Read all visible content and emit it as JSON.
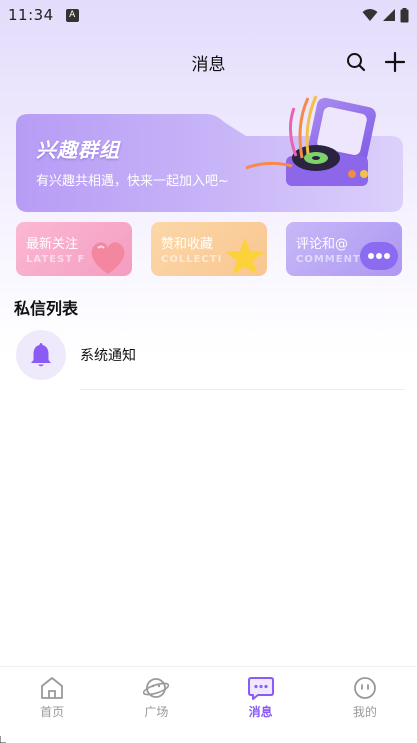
{
  "status_bar": {
    "time": "11:34",
    "badge": "A"
  },
  "header": {
    "title": "消息"
  },
  "banner": {
    "title": "兴趣群组",
    "subtitle": "有兴趣共相遇，快来一起加入吧~"
  },
  "cards": [
    {
      "label": "最新关注",
      "en": "LATEST F",
      "color": "#f7a7c8"
    },
    {
      "label": "赞和收藏",
      "en": "COLLECTI",
      "color": "#fbcf9d"
    },
    {
      "label": "评论和@",
      "en": "COMMENT",
      "color": "#b8a6f5"
    }
  ],
  "section_title": "私信列表",
  "dm_list": [
    {
      "name": "系统通知",
      "icon": "bell-icon"
    }
  ],
  "tabs": [
    {
      "label": "首页",
      "icon": "home-icon",
      "active": false
    },
    {
      "label": "广场",
      "icon": "planet-icon",
      "active": false
    },
    {
      "label": "消息",
      "icon": "message-icon",
      "active": true
    },
    {
      "label": "我的",
      "icon": "face-icon",
      "active": false
    }
  ],
  "colors": {
    "accent": "#8a5cf5",
    "inactive": "#999999"
  }
}
